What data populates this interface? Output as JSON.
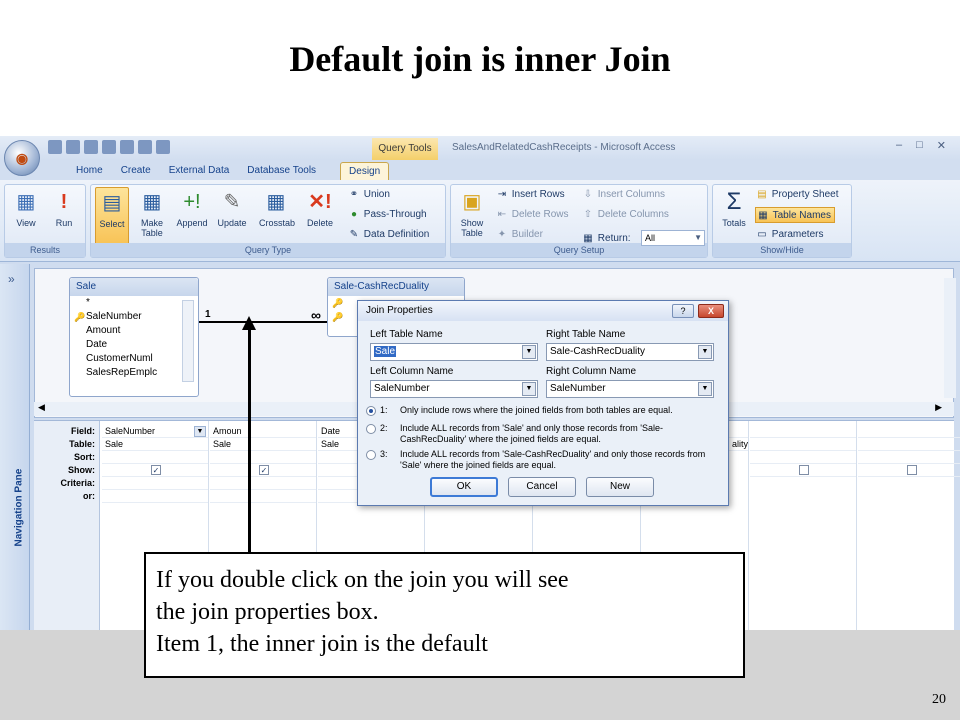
{
  "slide": {
    "title": "Default join is inner Join",
    "page_number": "20",
    "callout_lines": [
      "If you double click on the join you will see",
      "the join properties box.",
      "Item 1, the inner join is the default"
    ]
  },
  "window": {
    "context_tab": "Query Tools",
    "title": "SalesAndRelatedCashReceipts - Microsoft Access"
  },
  "ribbon": {
    "tabs": [
      "Home",
      "Create",
      "External Data",
      "Database Tools",
      "Design"
    ],
    "active_tab": "Design",
    "results": {
      "label": "Results",
      "view": "View",
      "run": "Run"
    },
    "query_type": {
      "label": "Query Type",
      "select": "Select",
      "make_table": "Make Table",
      "append": "Append",
      "update": "Update",
      "crosstab": "Crosstab",
      "delete": "Delete",
      "union": "Union",
      "pass_through": "Pass-Through",
      "data_definition": "Data Definition"
    },
    "query_setup": {
      "label": "Query Setup",
      "show_table": "Show Table",
      "insert_rows": "Insert Rows",
      "delete_rows": "Delete Rows",
      "builder": "Builder",
      "insert_columns": "Insert Columns",
      "delete_columns": "Delete Columns",
      "return": "Return:",
      "return_value": "All"
    },
    "show_hide": {
      "label": "Show/Hide",
      "totals": "Totals",
      "property_sheet": "Property Sheet",
      "table_names": "Table Names",
      "parameters": "Parameters"
    }
  },
  "nav_pane": {
    "label": "Navigation Pane"
  },
  "tables": [
    {
      "name": "Sale",
      "fields": [
        "*",
        "SaleNumber",
        "Amount",
        "Date",
        "CustomerNuml",
        "SalesRepEmplc"
      ]
    },
    {
      "name": "Sale-CashRecDuality"
    }
  ],
  "join": {
    "left_label": "1",
    "right_label": "∞"
  },
  "grid": {
    "row_labels": [
      "Field:",
      "Table:",
      "Sort:",
      "Show:",
      "Criteria:",
      "or:"
    ],
    "columns": [
      {
        "field": "SaleNumber",
        "table": "Sale",
        "show": true
      },
      {
        "field": "Amoun",
        "table": "Sale",
        "show": true
      },
      {
        "field": "Date",
        "table": "Sale",
        "show": false
      },
      {
        "field": "",
        "table": "",
        "show": false
      },
      {
        "field": "",
        "table": "",
        "show": false
      },
      {
        "field": "",
        "table": "ality",
        "show": false
      },
      {
        "field": "",
        "table": "",
        "show": true
      },
      {
        "field": "",
        "table": "",
        "show": true
      }
    ]
  },
  "dialog": {
    "title": "Join Properties",
    "help_label": "?",
    "close_label": "X",
    "left_table_label": "Left Table Name",
    "left_table_value": "Sale",
    "right_table_label": "Right Table Name",
    "right_table_value": "Sale-CashRecDuality",
    "left_column_label": "Left Column Name",
    "left_column_value": "SaleNumber",
    "right_column_label": "Right Column Name",
    "right_column_value": "SaleNumber",
    "options": [
      {
        "num": "1:",
        "text": "Only include rows where the joined fields from both tables are equal.",
        "selected": true
      },
      {
        "num": "2:",
        "text": "Include ALL records from 'Sale' and only those records from 'Sale-CashRecDuality' where the joined fields are equal.",
        "selected": false
      },
      {
        "num": "3:",
        "text": "Include ALL records from 'Sale-CashRecDuality' and only those records from 'Sale' where the joined fields are equal.",
        "selected": false
      }
    ],
    "ok": "OK",
    "cancel": "Cancel",
    "new": "New"
  },
  "colors": {
    "accent": "#15428b",
    "selected": "#f8c356"
  }
}
